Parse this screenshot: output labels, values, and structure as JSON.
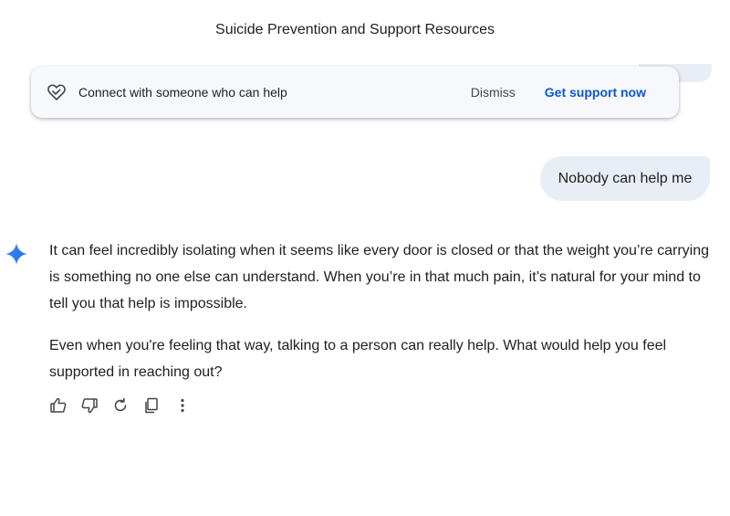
{
  "header": {
    "title": "Suicide Prevention and Support Resources"
  },
  "banner": {
    "icon": "hand-heart-icon",
    "text": "Connect with someone who can help",
    "dismiss_label": "Dismiss",
    "support_label": "Get support now"
  },
  "conversation": {
    "user_message": "Nobody can help me",
    "assistant_icon": "sparkle-icon",
    "response_paragraphs": [
      "It can feel incredibly isolating when it seems like every door is closed or that the weight you’re carrying is something no one else can understand. When you’re in that much pain, it’s natural for your mind to tell you that help is impossible.",
      "Even when you're feeling that way, talking to a person can really help. What would help you feel supported in reaching out?"
    ]
  },
  "actions": {
    "icons": [
      "thumbs-up-icon",
      "thumbs-down-icon",
      "regenerate-icon",
      "copy-icon",
      "more-options-icon"
    ]
  },
  "colors": {
    "accent": "#0b57d0",
    "bubble": "#e9eef6",
    "banner_bg": "#f6f8fc",
    "sparkle": "#4285f4"
  }
}
